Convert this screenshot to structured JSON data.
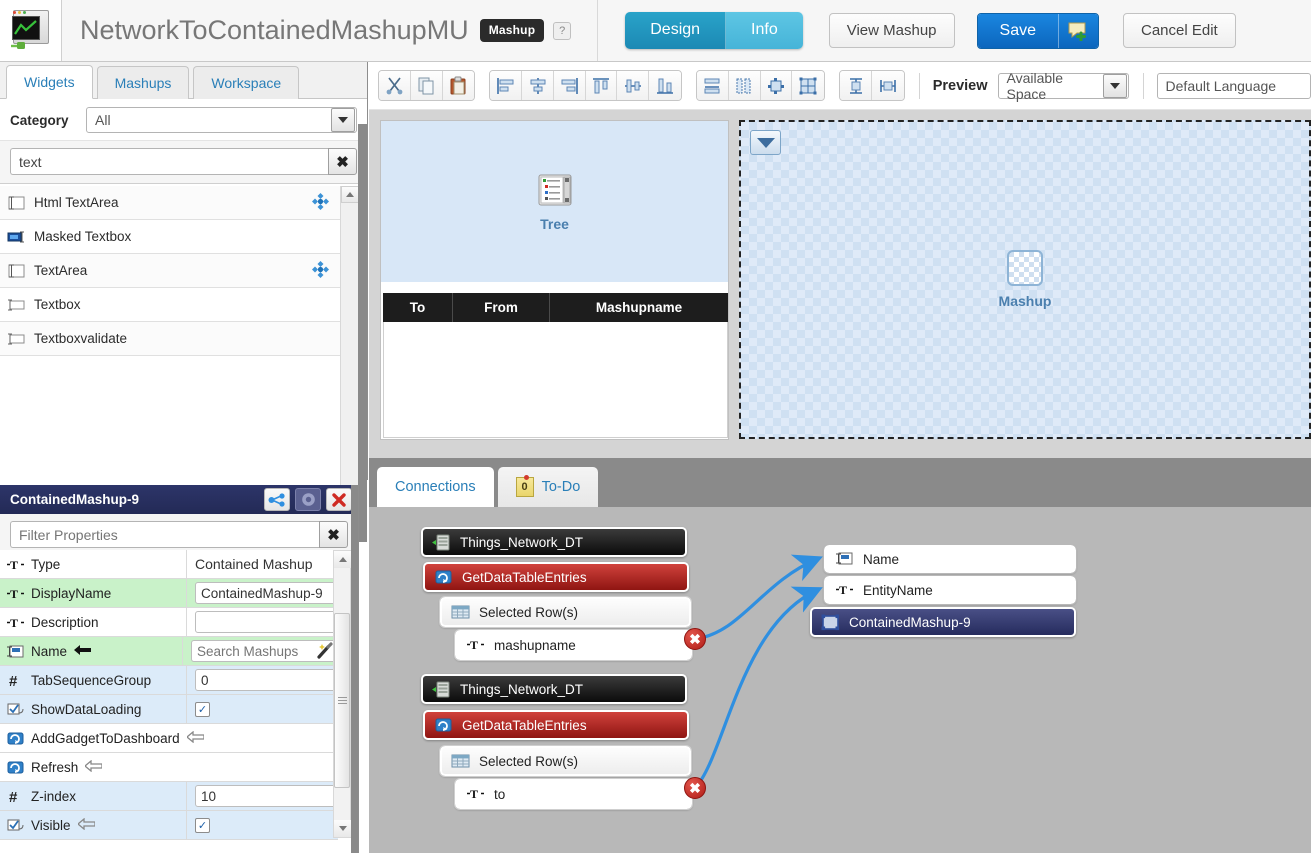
{
  "header": {
    "logo_icon": "thingworx-monitor-icon",
    "title": "NetworkToContainedMashupMU",
    "type_badge": "Mashup",
    "help_label": "?",
    "segments": [
      {
        "label": "Design",
        "active": true
      },
      {
        "label": "Info",
        "active": false
      }
    ],
    "view_mashup_label": "View Mashup",
    "save_label": "Save",
    "save_extra_icon": "comment-add-icon",
    "cancel_edit_label": "Cancel Edit"
  },
  "left_panel": {
    "tabs": [
      {
        "label": "Widgets",
        "active": true
      },
      {
        "label": "Mashups",
        "active": false
      },
      {
        "label": "Workspace",
        "active": false
      }
    ],
    "category_label": "Category",
    "category_value": "All",
    "search_value": "text",
    "search_placeholder": "",
    "clear_icon": "clear-x-icon",
    "widgets": [
      {
        "label": "Html TextArea",
        "icon": "textarea-icon",
        "draggable": true
      },
      {
        "label": "Masked Textbox",
        "icon": "masked-textbox-icon",
        "draggable": false
      },
      {
        "label": "TextArea",
        "icon": "textarea-icon",
        "draggable": true
      },
      {
        "label": "Textbox",
        "icon": "textbox-icon",
        "draggable": false
      },
      {
        "label": "Textboxvalidate",
        "icon": "textbox-icon",
        "draggable": false
      }
    ]
  },
  "properties": {
    "title": "ContainedMashup-9",
    "header_buttons": [
      {
        "icon": "bindings-icon",
        "name": "show-bindings-button"
      },
      {
        "icon": "gear-icon",
        "name": "settings-button"
      },
      {
        "icon": "close-x-icon",
        "name": "close-panel-button"
      }
    ],
    "filter_placeholder": "Filter Properties",
    "filter_value": "",
    "rows": [
      {
        "name": "Type",
        "icon": "string-type-icon",
        "kind": "text",
        "value": "Contained Mashup",
        "row_style": "white",
        "bound": false
      },
      {
        "name": "DisplayName",
        "icon": "string-type-icon",
        "kind": "input",
        "value": "ContainedMashup-9",
        "row_style": "green",
        "bound": false
      },
      {
        "name": "Description",
        "icon": "string-type-icon",
        "kind": "input",
        "value": "",
        "row_style": "white",
        "bound": false
      },
      {
        "name": "Name",
        "icon": "mashup-type-icon",
        "kind": "search",
        "value": "",
        "placeholder": "Search Mashups",
        "row_style": "green",
        "bound": true
      },
      {
        "name": "TabSequenceGroup",
        "icon": "number-type-icon",
        "kind": "input",
        "value": "0",
        "row_style": "blue",
        "bound": false
      },
      {
        "name": "ShowDataLoading",
        "icon": "boolean-type-icon",
        "kind": "checkbox",
        "value": true,
        "row_style": "blue",
        "bound": false
      },
      {
        "name": "AddGadgetToDashboard",
        "icon": "service-type-icon",
        "kind": "service",
        "row_style": "white",
        "bound": true
      },
      {
        "name": "Refresh",
        "icon": "service-type-icon",
        "kind": "service",
        "row_style": "white",
        "bound": true
      },
      {
        "name": "Z-index",
        "icon": "number-type-icon",
        "kind": "input",
        "value": "10",
        "row_style": "blue",
        "bound": false
      },
      {
        "name": "Visible",
        "icon": "boolean-type-icon",
        "kind": "checkbox",
        "value": true,
        "row_style": "blue",
        "bound": true
      }
    ]
  },
  "design_toolbar": {
    "groups": [
      {
        "icons": [
          "cut-icon",
          "copy-icon",
          "paste-icon"
        ]
      },
      {
        "icons": [
          "align-left-icon",
          "align-center-h-icon",
          "align-right-icon",
          "align-top-icon",
          "align-middle-v-icon",
          "align-bottom-icon"
        ]
      },
      {
        "icons": [
          "distribute-h-icon",
          "distribute-v-icon",
          "fit-to-content-icon",
          "grid-layout-icon"
        ]
      },
      {
        "icons": [
          "same-height-icon",
          "same-width-icon"
        ]
      }
    ],
    "preview_label": "Preview",
    "preview_value": "Available Space",
    "language_value": "Default Language"
  },
  "canvas": {
    "tree_widget": {
      "caption": "Tree",
      "icon": "tree-widget-icon"
    },
    "grid_widget": {
      "columns": [
        "To",
        "From",
        "Mashupname"
      ],
      "rows": []
    },
    "mashup_container": {
      "caption": "Mashup",
      "icon": "mashup-checker-icon",
      "dropdown_icon": "caret-down-icon"
    }
  },
  "connections": {
    "tabs": [
      {
        "label": "Connections",
        "active": true,
        "icon": null,
        "badge": null
      },
      {
        "label": "To-Do",
        "active": false,
        "icon": "sticky-note-icon",
        "badge": "0"
      }
    ],
    "source_groups": [
      {
        "entity": "Things_Network_DT",
        "service": "GetDataTableEntries",
        "output": "Selected Row(s)",
        "field": "mashupname",
        "error_icon": "remove-binding-icon"
      },
      {
        "entity": "Things_Network_DT",
        "service": "GetDataTableEntries",
        "output": "Selected Row(s)",
        "field": "to",
        "error_icon": "remove-binding-icon"
      }
    ],
    "targets": [
      {
        "label": "Name",
        "icon": "mashup-type-icon",
        "kind": "target"
      },
      {
        "label": "EntityName",
        "icon": "string-type-icon",
        "kind": "target"
      },
      {
        "label": "ContainedMashup-9",
        "icon": "widget-icon",
        "kind": "widget"
      }
    ]
  },
  "colors": {
    "accent_blue": "#2a7fb8",
    "save_blue": "#0c66bd",
    "service_red": "#8f1512",
    "widget_navy": "#262c5e",
    "bound_green": "#c9f2c9",
    "row_blue": "#dcebf9",
    "link_blue": "#2f8fe0",
    "canvas_gray": "#b8b8b8"
  }
}
